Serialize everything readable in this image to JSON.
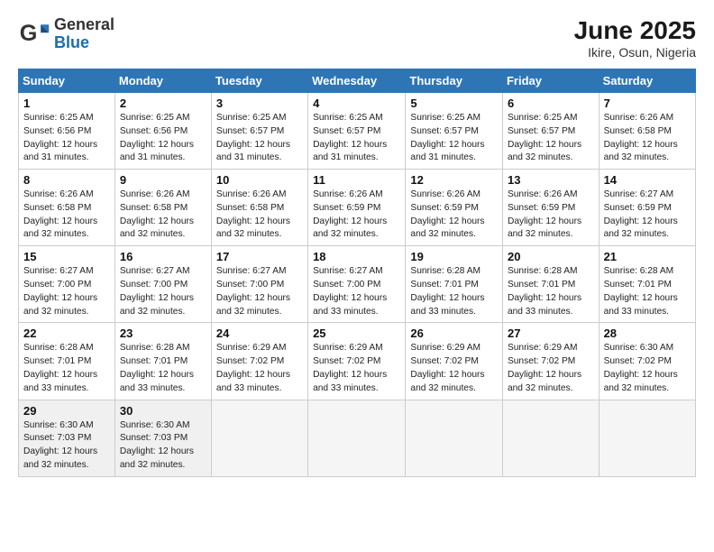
{
  "header": {
    "logo_general": "General",
    "logo_blue": "Blue",
    "month_year": "June 2025",
    "location": "Ikire, Osun, Nigeria"
  },
  "days_of_week": [
    "Sunday",
    "Monday",
    "Tuesday",
    "Wednesday",
    "Thursday",
    "Friday",
    "Saturday"
  ],
  "weeks": [
    [
      {
        "day": 1,
        "sunrise": "6:25 AM",
        "sunset": "6:56 PM",
        "daylight": "12 hours and 31 minutes."
      },
      {
        "day": 2,
        "sunrise": "6:25 AM",
        "sunset": "6:56 PM",
        "daylight": "12 hours and 31 minutes."
      },
      {
        "day": 3,
        "sunrise": "6:25 AM",
        "sunset": "6:57 PM",
        "daylight": "12 hours and 31 minutes."
      },
      {
        "day": 4,
        "sunrise": "6:25 AM",
        "sunset": "6:57 PM",
        "daylight": "12 hours and 31 minutes."
      },
      {
        "day": 5,
        "sunrise": "6:25 AM",
        "sunset": "6:57 PM",
        "daylight": "12 hours and 31 minutes."
      },
      {
        "day": 6,
        "sunrise": "6:25 AM",
        "sunset": "6:57 PM",
        "daylight": "12 hours and 32 minutes."
      },
      {
        "day": 7,
        "sunrise": "6:26 AM",
        "sunset": "6:58 PM",
        "daylight": "12 hours and 32 minutes."
      }
    ],
    [
      {
        "day": 8,
        "sunrise": "6:26 AM",
        "sunset": "6:58 PM",
        "daylight": "12 hours and 32 minutes."
      },
      {
        "day": 9,
        "sunrise": "6:26 AM",
        "sunset": "6:58 PM",
        "daylight": "12 hours and 32 minutes."
      },
      {
        "day": 10,
        "sunrise": "6:26 AM",
        "sunset": "6:58 PM",
        "daylight": "12 hours and 32 minutes."
      },
      {
        "day": 11,
        "sunrise": "6:26 AM",
        "sunset": "6:59 PM",
        "daylight": "12 hours and 32 minutes."
      },
      {
        "day": 12,
        "sunrise": "6:26 AM",
        "sunset": "6:59 PM",
        "daylight": "12 hours and 32 minutes."
      },
      {
        "day": 13,
        "sunrise": "6:26 AM",
        "sunset": "6:59 PM",
        "daylight": "12 hours and 32 minutes."
      },
      {
        "day": 14,
        "sunrise": "6:27 AM",
        "sunset": "6:59 PM",
        "daylight": "12 hours and 32 minutes."
      }
    ],
    [
      {
        "day": 15,
        "sunrise": "6:27 AM",
        "sunset": "7:00 PM",
        "daylight": "12 hours and 32 minutes."
      },
      {
        "day": 16,
        "sunrise": "6:27 AM",
        "sunset": "7:00 PM",
        "daylight": "12 hours and 32 minutes."
      },
      {
        "day": 17,
        "sunrise": "6:27 AM",
        "sunset": "7:00 PM",
        "daylight": "12 hours and 32 minutes."
      },
      {
        "day": 18,
        "sunrise": "6:27 AM",
        "sunset": "7:00 PM",
        "daylight": "12 hours and 33 minutes."
      },
      {
        "day": 19,
        "sunrise": "6:28 AM",
        "sunset": "7:01 PM",
        "daylight": "12 hours and 33 minutes."
      },
      {
        "day": 20,
        "sunrise": "6:28 AM",
        "sunset": "7:01 PM",
        "daylight": "12 hours and 33 minutes."
      },
      {
        "day": 21,
        "sunrise": "6:28 AM",
        "sunset": "7:01 PM",
        "daylight": "12 hours and 33 minutes."
      }
    ],
    [
      {
        "day": 22,
        "sunrise": "6:28 AM",
        "sunset": "7:01 PM",
        "daylight": "12 hours and 33 minutes."
      },
      {
        "day": 23,
        "sunrise": "6:28 AM",
        "sunset": "7:01 PM",
        "daylight": "12 hours and 33 minutes."
      },
      {
        "day": 24,
        "sunrise": "6:29 AM",
        "sunset": "7:02 PM",
        "daylight": "12 hours and 33 minutes."
      },
      {
        "day": 25,
        "sunrise": "6:29 AM",
        "sunset": "7:02 PM",
        "daylight": "12 hours and 33 minutes."
      },
      {
        "day": 26,
        "sunrise": "6:29 AM",
        "sunset": "7:02 PM",
        "daylight": "12 hours and 32 minutes."
      },
      {
        "day": 27,
        "sunrise": "6:29 AM",
        "sunset": "7:02 PM",
        "daylight": "12 hours and 32 minutes."
      },
      {
        "day": 28,
        "sunrise": "6:30 AM",
        "sunset": "7:02 PM",
        "daylight": "12 hours and 32 minutes."
      }
    ],
    [
      {
        "day": 29,
        "sunrise": "6:30 AM",
        "sunset": "7:03 PM",
        "daylight": "12 hours and 32 minutes."
      },
      {
        "day": 30,
        "sunrise": "6:30 AM",
        "sunset": "7:03 PM",
        "daylight": "12 hours and 32 minutes."
      },
      null,
      null,
      null,
      null,
      null
    ]
  ]
}
